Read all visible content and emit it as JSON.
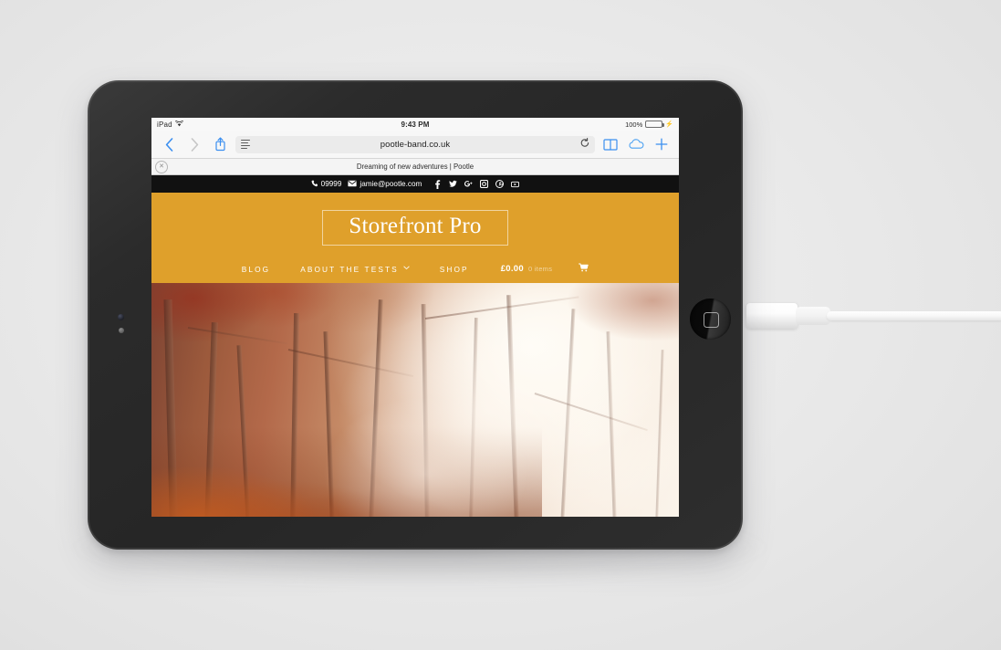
{
  "device": {
    "name": "iPad",
    "home_button": "home-button",
    "camera": "front-camera",
    "cable": "lightning-cable"
  },
  "status_bar": {
    "carrier_label": "iPad",
    "wifi": "wifi-icon",
    "time": "9:43 PM",
    "battery_percent": "100%",
    "battery_state": "charging"
  },
  "browser": {
    "back_icon": "‹",
    "forward_icon": "›",
    "share_icon": "share-icon",
    "reader_icon": "reader-view-icon",
    "url": "pootle-band.co.uk",
    "reload_icon": "↻",
    "bookmarks_icon": "book-icon",
    "cloud_tabs_icon": "cloud-icon",
    "new_tab_icon": "+",
    "tab": {
      "title": "Dreaming of new adventures | Pootle",
      "close_icon": "✕"
    }
  },
  "site": {
    "contact_bar": {
      "phone_icon": "phone-icon",
      "phone": "09999",
      "email_icon": "envelope-icon",
      "email": "jamie@pootle.com",
      "social": [
        {
          "name": "facebook-icon",
          "glyph": "f"
        },
        {
          "name": "twitter-icon",
          "glyph": "t"
        },
        {
          "name": "googleplus-icon",
          "glyph": "g+"
        },
        {
          "name": "instagram-icon",
          "glyph": "ig"
        },
        {
          "name": "pinterest-icon",
          "glyph": "p"
        },
        {
          "name": "youtube-icon",
          "glyph": "yt"
        }
      ]
    },
    "logo": "Storefront Pro",
    "nav": [
      {
        "label": "BLOG",
        "has_caret": false
      },
      {
        "label": "ABOUT THE TESTS",
        "has_caret": true
      },
      {
        "label": "SHOP",
        "has_caret": false
      }
    ],
    "cart": {
      "price": "£0.00",
      "items": "0 items",
      "icon": "shopping-cart-icon"
    },
    "hero": {
      "alt": "Misty autumn forest with red-orange foliage and a sunlit path"
    },
    "colors": {
      "brand_orange": "#dfa02b",
      "contact_bar": "#111111",
      "logo_text": "#ffffff"
    }
  }
}
